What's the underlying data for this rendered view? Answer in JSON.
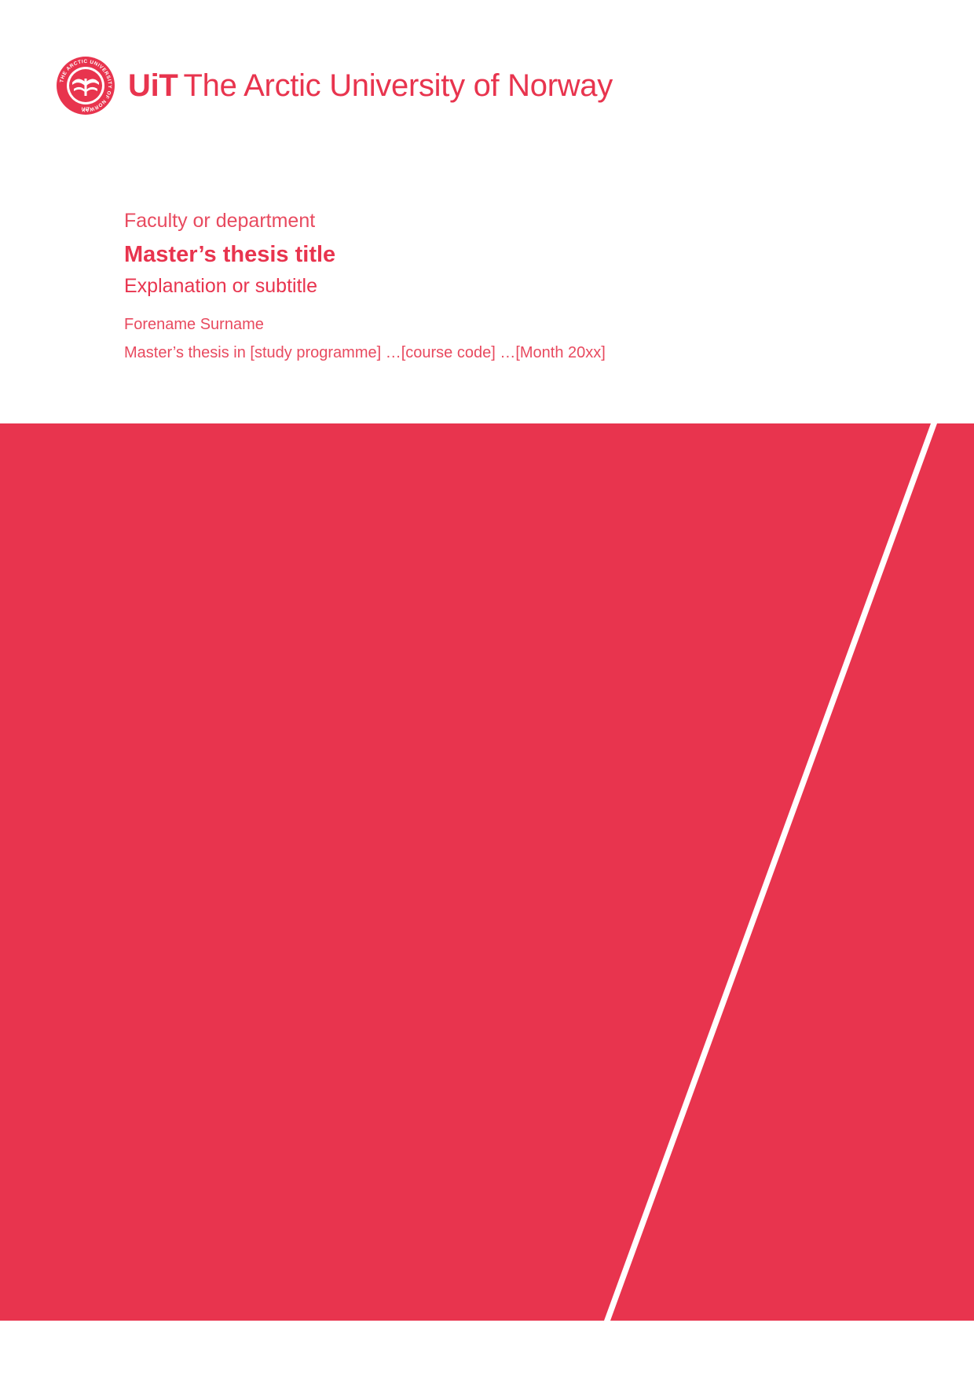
{
  "header": {
    "logo_abbr": "UiT",
    "logo_name": "The Arctic University of Norway",
    "seal_icon": "uit-seal-icon",
    "seal_ring_text": "THE ARCTIC UNIVERSITY OF NORWAY",
    "seal_bottom_text": "UiT"
  },
  "cover": {
    "faculty": "Faculty or department",
    "title": "Master’s thesis title",
    "subtitle": "Explanation or subtitle",
    "author": "Forename Surname",
    "program_line": "Master’s thesis in [study programme] …[course code] …[Month 20xx]"
  },
  "colors": {
    "brand_red": "#e8344e",
    "text_light_red": "#e84a5f",
    "background": "#ffffff",
    "stripe": "#ffffff"
  }
}
